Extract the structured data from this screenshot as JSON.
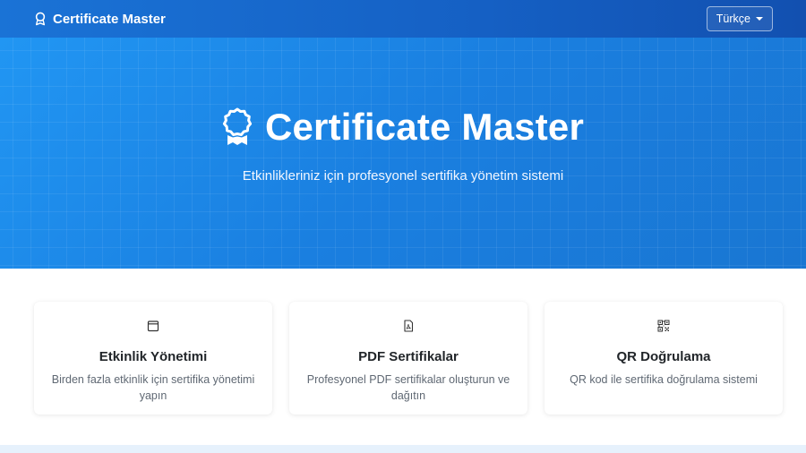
{
  "navbar": {
    "brand": "Certificate Master",
    "brand_icon": "award-icon",
    "language_button": "Türkçe"
  },
  "hero": {
    "title": "Certificate Master",
    "icon": "award-icon",
    "subtitle": "Etkinlikleriniz için profesyonel sertifika yönetim sistemi",
    "background_color": "#1e88e5"
  },
  "features": [
    {
      "icon": "calendar-icon",
      "title": "Etkinlik Yönetimi",
      "text": "Birden fazla etkinlik için sertifika yönetimi yapın"
    },
    {
      "icon": "pdf-file-icon",
      "title": "PDF Sertifikalar",
      "text": "Profesyonel PDF sertifikalar oluşturun ve dağıtın"
    },
    {
      "icon": "qr-code-icon",
      "title": "QR Doğrulama",
      "text": "QR kod ile sertifika doğrulama sistemi"
    }
  ]
}
